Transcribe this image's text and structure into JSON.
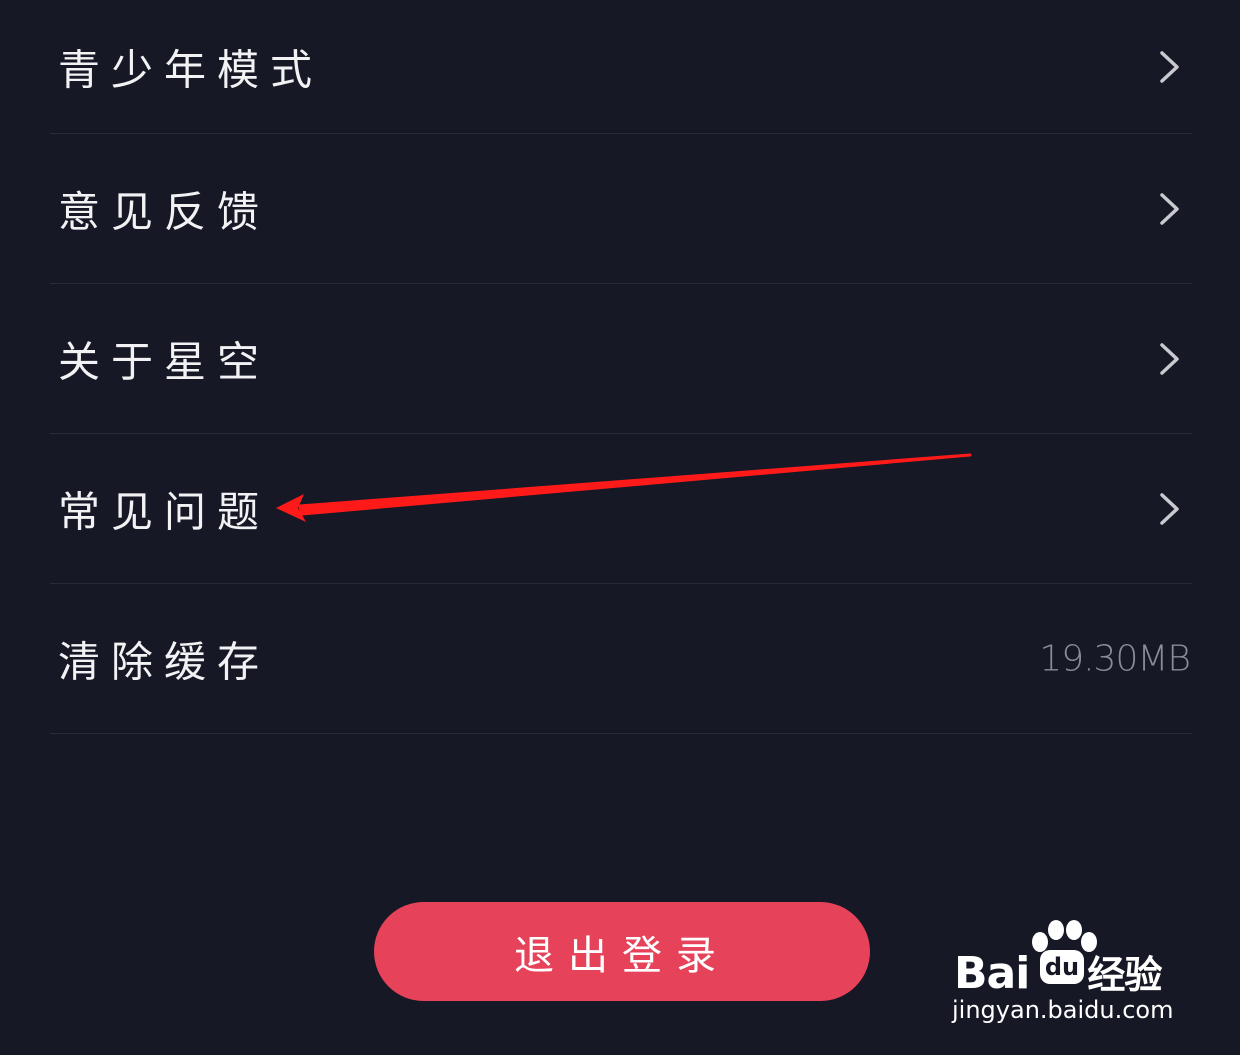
{
  "settings": {
    "items": [
      {
        "label": "青少年模式",
        "has_chevron": true
      },
      {
        "label": "意见反馈",
        "has_chevron": true
      },
      {
        "label": "关于星空",
        "has_chevron": true
      },
      {
        "label": "常见问题",
        "has_chevron": true
      },
      {
        "label": "清除缓存",
        "value": "19.30MB"
      }
    ]
  },
  "logout": {
    "label": "退出登录",
    "color": "#e6425a"
  },
  "watermark": {
    "brand_left": "Bai",
    "brand_mid": "du",
    "brand_right": "经验",
    "url": "jingyan.baidu.com"
  },
  "annotation": {
    "arrow_color": "#ff1a1a"
  }
}
